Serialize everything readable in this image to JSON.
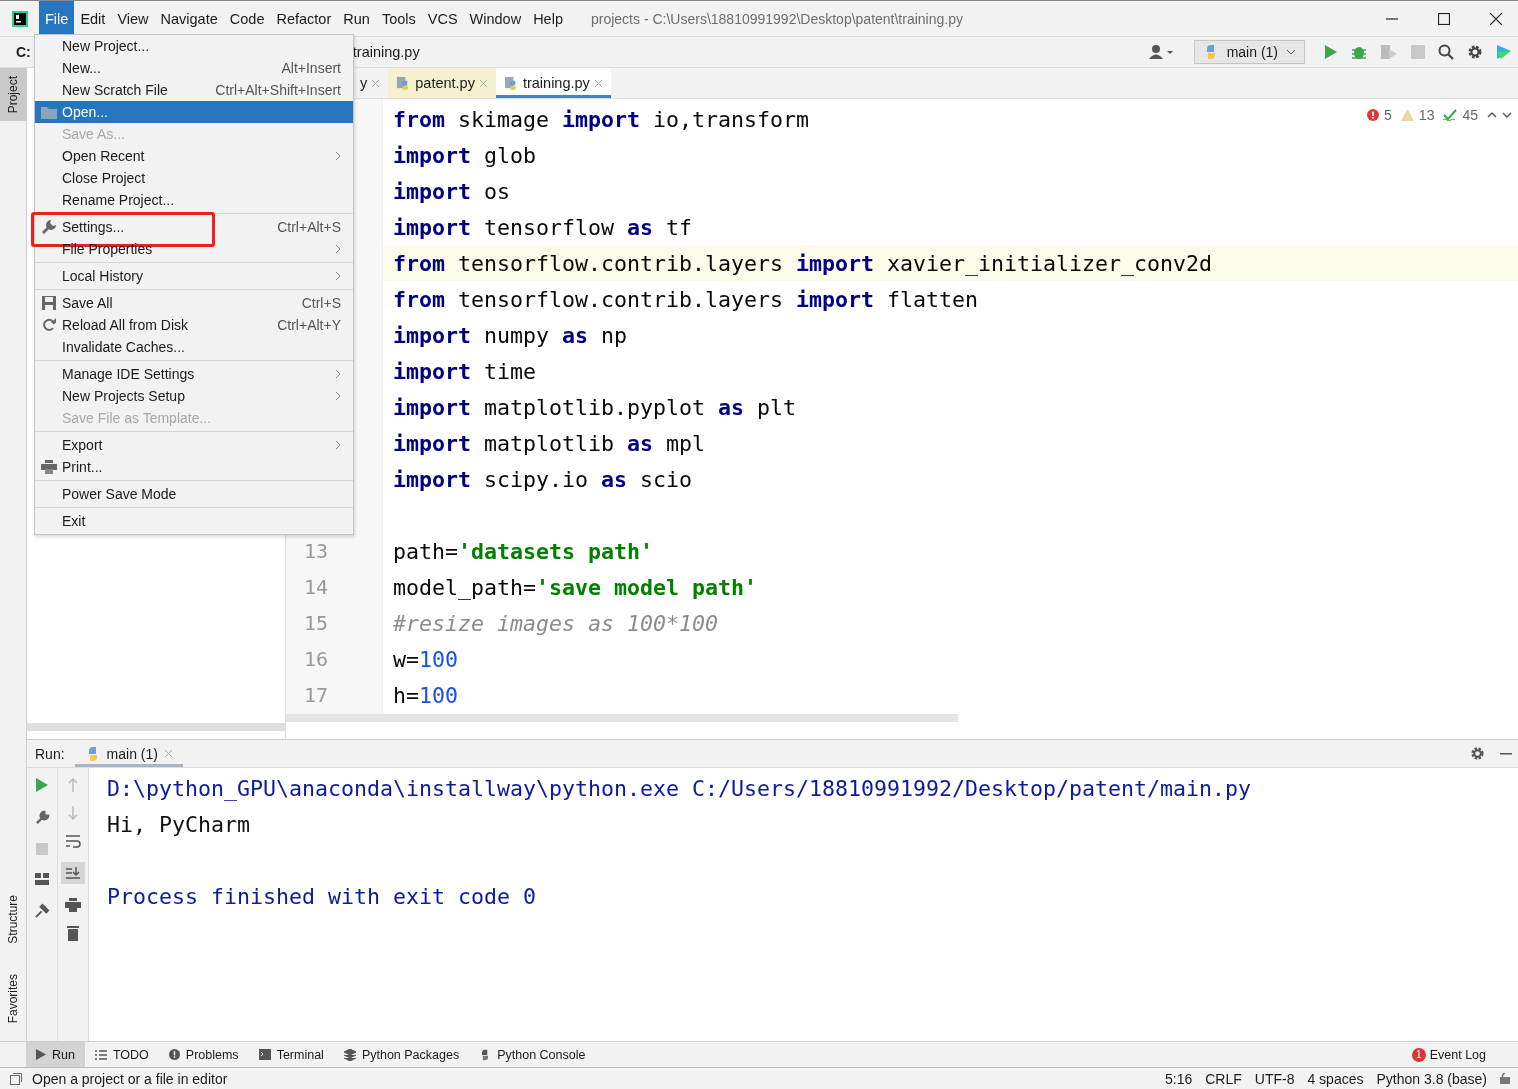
{
  "window": {
    "title": "projects - C:\\Users\\18810991992\\Desktop\\patent\\training.py"
  },
  "menu_bar": [
    {
      "label": "File",
      "selected": true
    },
    {
      "label": "Edit",
      "selected": false
    },
    {
      "label": "View",
      "selected": false
    },
    {
      "label": "Navigate",
      "selected": false
    },
    {
      "label": "Code",
      "selected": false
    },
    {
      "label": "Refactor",
      "selected": false
    },
    {
      "label": "Run",
      "selected": false
    },
    {
      "label": "Tools",
      "selected": false
    },
    {
      "label": "VCS",
      "selected": false
    },
    {
      "label": "Window",
      "selected": false
    },
    {
      "label": "Help",
      "selected": false
    }
  ],
  "file_menu": [
    {
      "kind": "plain",
      "label": "New Project...",
      "disabled": false,
      "selected": false,
      "submenu": false,
      "annotated": false
    },
    {
      "kind": "plain",
      "label": "New...",
      "shortcut": "Alt+Insert",
      "disabled": false,
      "selected": false,
      "submenu": false,
      "annotated": false
    },
    {
      "kind": "plain",
      "label": "New Scratch File",
      "shortcut": "Ctrl+Alt+Shift+Insert",
      "disabled": false,
      "selected": false,
      "submenu": false,
      "annotated": false
    },
    {
      "kind": "folder",
      "label": "Open...",
      "disabled": false,
      "selected": true,
      "submenu": false,
      "annotated": false
    },
    {
      "kind": "plain",
      "label": "Save As...",
      "disabled": true,
      "selected": false,
      "submenu": false,
      "annotated": false
    },
    {
      "kind": "plain",
      "label": "Open Recent",
      "disabled": false,
      "selected": false,
      "submenu": true,
      "annotated": false
    },
    {
      "kind": "plain",
      "label": "Close Project",
      "disabled": false,
      "selected": false,
      "submenu": false,
      "annotated": false
    },
    {
      "kind": "plain",
      "label": "Rename Project...",
      "disabled": false,
      "selected": false,
      "submenu": false,
      "annotated": false
    },
    {
      "kind": "separator"
    },
    {
      "kind": "wrench",
      "label": "Settings...",
      "shortcut": "Ctrl+Alt+S",
      "disabled": false,
      "selected": false,
      "submenu": false,
      "annotated": true
    },
    {
      "kind": "plain",
      "label": "File Properties",
      "disabled": false,
      "selected": false,
      "submenu": true,
      "annotated": false
    },
    {
      "kind": "separator"
    },
    {
      "kind": "plain",
      "label": "Local History",
      "disabled": false,
      "selected": false,
      "submenu": true,
      "annotated": false
    },
    {
      "kind": "separator"
    },
    {
      "kind": "save",
      "label": "Save All",
      "shortcut": "Ctrl+S",
      "disabled": false,
      "selected": false,
      "submenu": false,
      "annotated": false
    },
    {
      "kind": "reload",
      "label": "Reload All from Disk",
      "shortcut": "Ctrl+Alt+Y",
      "disabled": false,
      "selected": false,
      "submenu": false,
      "annotated": false
    },
    {
      "kind": "plain",
      "label": "Invalidate Caches...",
      "disabled": false,
      "selected": false,
      "submenu": false,
      "annotated": false
    },
    {
      "kind": "separator"
    },
    {
      "kind": "plain",
      "label": "Manage IDE Settings",
      "disabled": false,
      "selected": false,
      "submenu": true,
      "annotated": false
    },
    {
      "kind": "plain",
      "label": "New Projects Setup",
      "disabled": false,
      "selected": false,
      "submenu": true,
      "annotated": false
    },
    {
      "kind": "plain",
      "label": "Save File as Template...",
      "disabled": true,
      "selected": false,
      "submenu": false,
      "annotated": false
    },
    {
      "kind": "separator"
    },
    {
      "kind": "plain",
      "label": "Export",
      "disabled": false,
      "selected": false,
      "submenu": true,
      "annotated": false
    },
    {
      "kind": "print",
      "label": "Print...",
      "disabled": false,
      "selected": false,
      "submenu": false,
      "annotated": false
    },
    {
      "kind": "separator"
    },
    {
      "kind": "plain",
      "label": "Power Save Mode",
      "disabled": false,
      "selected": false,
      "submenu": false,
      "annotated": false
    },
    {
      "kind": "separator"
    },
    {
      "kind": "plain",
      "label": "Exit",
      "disabled": false,
      "selected": false,
      "submenu": false,
      "annotated": false
    }
  ],
  "nav_bar": {
    "drive": "C:",
    "breadcrumb": "training.py",
    "run_config": "main (1)"
  },
  "editor_tabs": [
    {
      "label": "y",
      "selected": false,
      "modified": false
    },
    {
      "label": "patent.py",
      "selected": false,
      "modified": true
    },
    {
      "label": "training.py",
      "selected": true,
      "modified": false
    }
  ],
  "inspections": {
    "errors": "5",
    "warnings": "13",
    "typos": "45"
  },
  "code_lines": [
    {
      "highlighted": false,
      "tokens": [
        {
          "kind": "kw",
          "text": "from"
        },
        {
          "kind": "plain",
          "text": " skimage "
        },
        {
          "kind": "kw",
          "text": "import"
        },
        {
          "kind": "plain",
          "text": " io,transform"
        }
      ]
    },
    {
      "highlighted": false,
      "tokens": [
        {
          "kind": "kw",
          "text": "import"
        },
        {
          "kind": "plain",
          "text": " glob"
        }
      ]
    },
    {
      "highlighted": false,
      "tokens": [
        {
          "kind": "kw",
          "text": "import"
        },
        {
          "kind": "plain",
          "text": " os"
        }
      ]
    },
    {
      "highlighted": false,
      "tokens": [
        {
          "kind": "kw",
          "text": "import"
        },
        {
          "kind": "plain",
          "text": " tensorflow "
        },
        {
          "kind": "kw",
          "text": "as"
        },
        {
          "kind": "plain",
          "text": " tf"
        }
      ]
    },
    {
      "highlighted": true,
      "tokens": [
        {
          "kind": "kw",
          "text": "from"
        },
        {
          "kind": "plain",
          "text": " tensorflow.contrib.layers "
        },
        {
          "kind": "kw",
          "text": "import"
        },
        {
          "kind": "plain",
          "text": " xavier_initializer_conv2d"
        }
      ]
    },
    {
      "highlighted": false,
      "tokens": [
        {
          "kind": "kw",
          "text": "from"
        },
        {
          "kind": "plain",
          "text": " tensorflow.contrib.layers "
        },
        {
          "kind": "kw",
          "text": "import"
        },
        {
          "kind": "plain",
          "text": " flatten"
        }
      ]
    },
    {
      "highlighted": false,
      "tokens": [
        {
          "kind": "kw",
          "text": "import"
        },
        {
          "kind": "plain",
          "text": " numpy "
        },
        {
          "kind": "kw",
          "text": "as"
        },
        {
          "kind": "plain",
          "text": " np"
        }
      ]
    },
    {
      "highlighted": false,
      "tokens": [
        {
          "kind": "kw",
          "text": "import"
        },
        {
          "kind": "plain",
          "text": " time"
        }
      ]
    },
    {
      "highlighted": false,
      "tokens": [
        {
          "kind": "kw",
          "text": "import"
        },
        {
          "kind": "plain",
          "text": " matplotlib.pyplot "
        },
        {
          "kind": "kw",
          "text": "as"
        },
        {
          "kind": "plain",
          "text": " plt"
        }
      ]
    },
    {
      "highlighted": false,
      "tokens": [
        {
          "kind": "kw",
          "text": "import"
        },
        {
          "kind": "plain",
          "text": " matplotlib "
        },
        {
          "kind": "kw",
          "text": "as"
        },
        {
          "kind": "plain",
          "text": " mpl"
        }
      ]
    },
    {
      "highlighted": false,
      "tokens": [
        {
          "kind": "kw",
          "text": "import"
        },
        {
          "kind": "plain",
          "text": " scipy.io "
        },
        {
          "kind": "kw",
          "text": "as"
        },
        {
          "kind": "plain",
          "text": " scio"
        }
      ]
    },
    {
      "highlighted": false
    },
    {
      "highlighted": false,
      "number": "13",
      "tokens": [
        {
          "kind": "plain",
          "text": "path="
        },
        {
          "kind": "str",
          "text": "'datasets path'"
        }
      ]
    },
    {
      "highlighted": false,
      "number": "14",
      "tokens": [
        {
          "kind": "plain",
          "text": "model_path="
        },
        {
          "kind": "str",
          "text": "'save model path'"
        }
      ]
    },
    {
      "highlighted": false,
      "number": "15",
      "tokens": [
        {
          "kind": "comment",
          "text": "#resize images as 100*100"
        }
      ]
    },
    {
      "highlighted": false,
      "number": "16",
      "tokens": [
        {
          "kind": "plain",
          "text": "w="
        },
        {
          "kind": "num",
          "text": "100"
        }
      ]
    },
    {
      "highlighted": false,
      "number": "17",
      "tokens": [
        {
          "kind": "plain",
          "text": "h="
        },
        {
          "kind": "num",
          "text": "100"
        }
      ]
    }
  ],
  "run_panel": {
    "label": "Run:",
    "tab": "main (1)",
    "output": [
      {
        "kind": "system",
        "text": "D:\\python_GPU\\anaconda\\installway\\python.exe C:/Users/18810991992/Desktop/patent/main.py"
      },
      {
        "kind": "stdout",
        "text": "Hi, PyCharm"
      },
      {
        "kind": "blank"
      },
      {
        "kind": "system",
        "text": "Process finished with exit code 0"
      }
    ]
  },
  "side_tabs": [
    {
      "label": "Project",
      "selected": true
    },
    {
      "label": "Structure",
      "selected": false
    },
    {
      "label": "Favorites",
      "selected": false
    }
  ],
  "tool_tabs": [
    {
      "label": "Run",
      "selected": true
    },
    {
      "label": "TODO",
      "selected": false
    },
    {
      "label": "Problems",
      "selected": false
    },
    {
      "label": "Terminal",
      "selected": false
    },
    {
      "label": "Python Packages",
      "selected": false
    },
    {
      "label": "Python Console",
      "selected": false
    }
  ],
  "event_log": {
    "label": "Event Log",
    "count": "1"
  },
  "status_bar": {
    "message": "Open a project or a file in editor",
    "items": [
      "5:16",
      "CRLF",
      "UTF-8",
      "4 spaces",
      "Python 3.8 (base)"
    ]
  }
}
